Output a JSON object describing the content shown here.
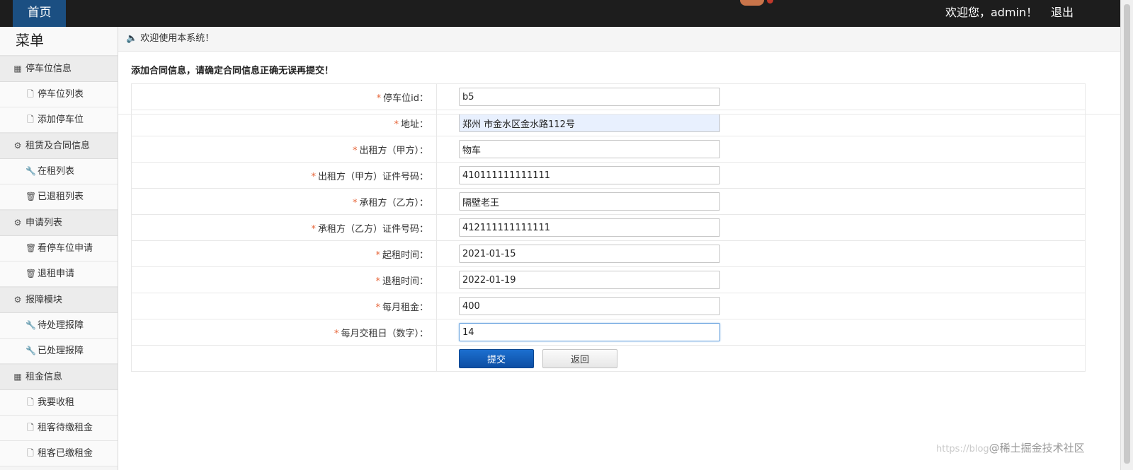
{
  "header": {
    "home_tab": "首页",
    "welcome": "欢迎您，admin！",
    "logout": "退出"
  },
  "sidebar": {
    "title": "菜单",
    "groups": [
      {
        "label": "停车位信息",
        "icon": "list-icon",
        "items": [
          {
            "label": "停车位列表",
            "icon": "file-icon"
          },
          {
            "label": "添加停车位",
            "icon": "file-icon"
          }
        ]
      },
      {
        "label": "租赁及合同信息",
        "icon": "gear-icon",
        "items": [
          {
            "label": "在租列表",
            "icon": "wrench-icon"
          },
          {
            "label": "已退租列表",
            "icon": "trash-icon"
          }
        ]
      },
      {
        "label": "申请列表",
        "icon": "gear-icon",
        "items": [
          {
            "label": "看停车位申请",
            "icon": "trash-icon"
          },
          {
            "label": "退租申请",
            "icon": "trash-icon"
          }
        ]
      },
      {
        "label": "报障模块",
        "icon": "gear-icon",
        "items": [
          {
            "label": "待处理报障",
            "icon": "wrench-icon"
          },
          {
            "label": "已处理报障",
            "icon": "wrench-icon"
          }
        ]
      },
      {
        "label": "租金信息",
        "icon": "list-icon",
        "items": [
          {
            "label": "我要收租",
            "icon": "file-icon"
          },
          {
            "label": "租客待缴租金",
            "icon": "file-icon"
          },
          {
            "label": "租客已缴租金",
            "icon": "file-icon"
          }
        ]
      }
    ]
  },
  "notice": {
    "text": "欢迎使用本系统！",
    "icon": "speaker-icon"
  },
  "form": {
    "title": "添加合同信息，请确定合同信息正确无误再提交！",
    "required_mark": "*",
    "fields": [
      {
        "label": "停车位id：",
        "value": "b5"
      },
      {
        "label": "地址：",
        "value": "郑州 市金水区金水路112号"
      },
      {
        "label": "出租方（甲方）：",
        "value": "物车"
      },
      {
        "label": "出租方（甲方）证件号码：",
        "value": "410111111111111"
      },
      {
        "label": "承租方（乙方）：",
        "value": "隔壁老王"
      },
      {
        "label": "承租方（乙方）证件号码：",
        "value": "412111111111111"
      },
      {
        "label": "起租时间：",
        "value": "2021-01-15"
      },
      {
        "label": "退租时间：",
        "value": "2022-01-19"
      },
      {
        "label": "每月租金：",
        "value": "400"
      },
      {
        "label": "每月交租日（数字）：",
        "value": "14"
      }
    ],
    "submit_label": "提交",
    "back_label": "返回"
  },
  "watermark": {
    "url": "https://blog",
    "text": "@稀土掘金技术社区"
  },
  "colors": {
    "topbar": "#1d1d1d",
    "home_tab": "#1b4f82",
    "primary_button": "#1565c0",
    "required": "#e7663a"
  }
}
